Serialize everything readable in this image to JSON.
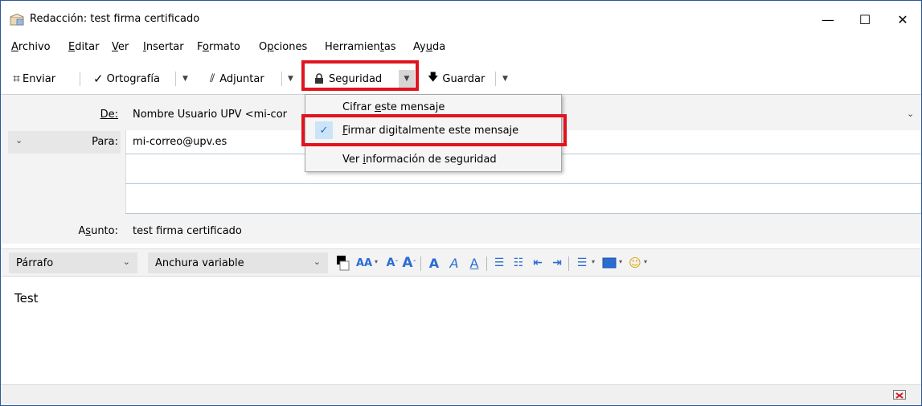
{
  "window": {
    "title": "Redacción: test firma certificado",
    "minimize": "—",
    "maximize": "☐",
    "close": "✕"
  },
  "menubar": {
    "items": [
      {
        "label": "Archivo",
        "accel": "A",
        "rest": "rchivo"
      },
      {
        "label": "Editar",
        "accel": "E",
        "rest": "ditar"
      },
      {
        "label": "Ver",
        "accel": "V",
        "rest": "er"
      },
      {
        "label": "Insertar",
        "accel": "I",
        "rest": "nsertar"
      },
      {
        "pre": "F",
        "accel": "o",
        "rest": "rmato"
      },
      {
        "pre": "O",
        "accel": "p",
        "rest": "ciones"
      },
      {
        "pre": "Herramien",
        "accel": "t",
        "rest": "as"
      },
      {
        "pre": "Ay",
        "accel": "u",
        "rest": "da"
      }
    ]
  },
  "toolbar": {
    "send": "Enviar",
    "spelling": "Ortografía",
    "attach": "Adjuntar",
    "security": "Seguridad",
    "save": "Guardar"
  },
  "header": {
    "from_label": "De:",
    "from_value": "Nombre Usuario UPV <mi-cor",
    "to_label": "Para:",
    "to_value": "mi-correo@upv.es",
    "subject_label_pre": "A",
    "subject_label_accel": "s",
    "subject_label_rest": "unto:",
    "subject_value": "test firma certificado"
  },
  "format_bar": {
    "paragraph": "Párrafo",
    "font": "Anchura variable"
  },
  "body": {
    "text": "Test"
  },
  "security_menu": {
    "items": [
      {
        "pre": "Cifrar ",
        "accel": "e",
        "rest": "ste mensaje",
        "checked": false
      },
      {
        "pre": "",
        "accel": "F",
        "rest": "irmar digitalmente este mensaje",
        "checked": true
      },
      {
        "pre": "Ver ",
        "accel": "i",
        "rest": "nformación de seguridad",
        "checked": false
      }
    ]
  },
  "colors": {
    "highlight": "#e0141e",
    "accent": "#2b6cd4"
  }
}
